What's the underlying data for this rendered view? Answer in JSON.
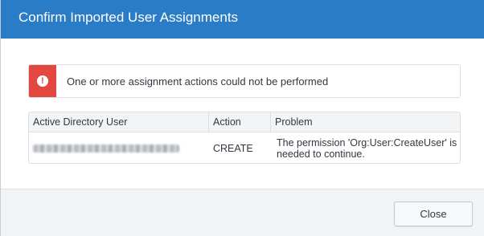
{
  "dialog": {
    "title": "Confirm Imported User Assignments"
  },
  "alert": {
    "icon": "exclamation-circle-icon",
    "icon_glyph": "!",
    "message": "One or more assignment actions could not be performed",
    "color": "#e2483f"
  },
  "table": {
    "columns": [
      "Active Directory User",
      "Action",
      "Problem"
    ],
    "rows": [
      {
        "user": "",
        "user_redacted": true,
        "action": "CREATE",
        "problem": "The permission 'Org:User:CreateUser' is needed to continue."
      }
    ]
  },
  "footer": {
    "close_label": "Close"
  },
  "colors": {
    "titlebar": "#2a7cc6",
    "error": "#e2483f"
  }
}
